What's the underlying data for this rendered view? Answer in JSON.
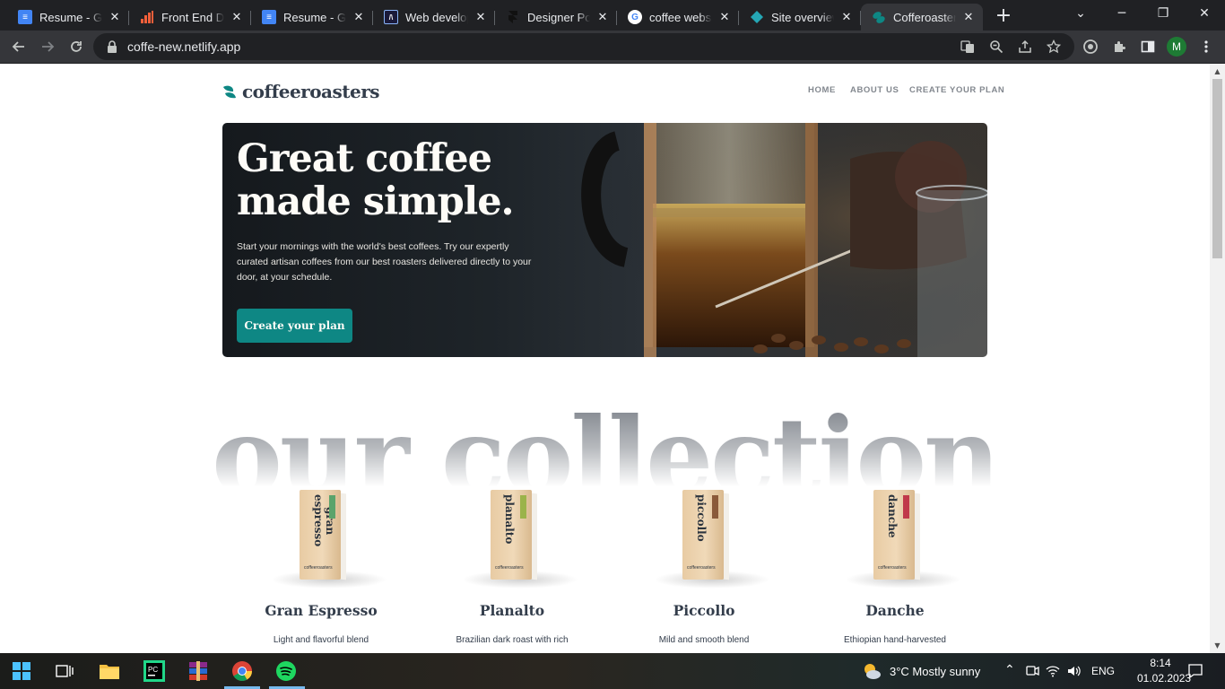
{
  "browser": {
    "tabs": [
      {
        "title": "Resume - Goo",
        "icon": "google-docs-icon",
        "active": false
      },
      {
        "title": "Front End Dev",
        "icon": "frontend-mentor-icon",
        "active": false
      },
      {
        "title": "Resume - Goo",
        "icon": "google-docs-icon",
        "active": false
      },
      {
        "title": "Web develop",
        "icon": "web-dev-icon",
        "active": false
      },
      {
        "title": "Designer Port",
        "icon": "framer-icon",
        "active": false
      },
      {
        "title": "coffee websit",
        "icon": "google-icon",
        "active": false
      },
      {
        "title": "Site overview",
        "icon": "netlify-icon",
        "active": false
      },
      {
        "title": "Cofferoasters",
        "icon": "coffee-bean-icon",
        "active": true
      }
    ],
    "url": "coffe-new.netlify.app",
    "profile_initial": "M"
  },
  "site": {
    "logo_text": "coffeeroasters",
    "nav": [
      "HOME",
      "ABOUT US",
      "CREATE YOUR PLAN"
    ],
    "hero": {
      "title": "Great coffee made simple.",
      "body": "Start your mornings with the world's best coffees. Try our expertly curated artisan coffees from our best roasters delivered directly to your door, at your schedule.",
      "cta": "Create your plan"
    },
    "collection_heading": "our collection",
    "products": [
      {
        "name": "Gran Espresso",
        "bag_label": "gran\nespresso",
        "tag_color": "#5aa36b",
        "desc": "Light and flavorful blend"
      },
      {
        "name": "Planalto",
        "bag_label": "planalto",
        "tag_color": "#9bb34a",
        "desc": "Brazilian dark roast with rich"
      },
      {
        "name": "Piccollo",
        "bag_label": "piccollo",
        "tag_color": "#8a5a3a",
        "desc": "Mild and smooth blend"
      },
      {
        "name": "Danche",
        "bag_label": "danche",
        "tag_color": "#c0394a",
        "desc": "Ethiopian hand-harvested"
      }
    ],
    "bag_brand": "coffeeroasters"
  },
  "taskbar": {
    "weather": "3°C  Mostly sunny",
    "language": "ENG",
    "time": "8:14",
    "date": "01.02.2023"
  },
  "colors": {
    "accent": "#0e8784",
    "dark_text": "#333d4b",
    "grey_text": "#83888f"
  }
}
